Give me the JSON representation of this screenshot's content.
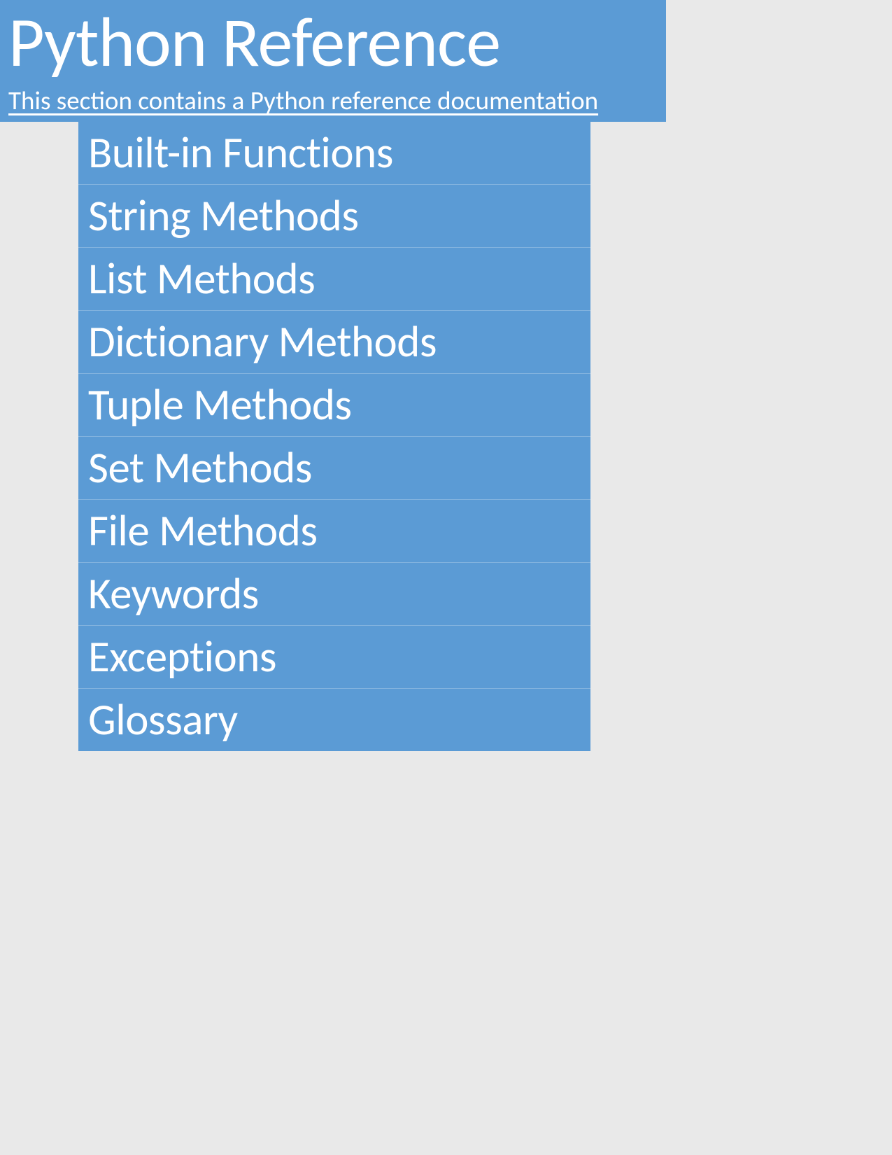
{
  "header": {
    "title": "Python Reference",
    "subtitle": "This section contains a Python reference documentation"
  },
  "menu": {
    "items": [
      {
        "label": "Built-in Functions"
      },
      {
        "label": "String Methods"
      },
      {
        "label": "List Methods"
      },
      {
        "label": "Dictionary Methods"
      },
      {
        "label": "Tuple Methods"
      },
      {
        "label": "Set Methods"
      },
      {
        "label": "File Methods"
      },
      {
        "label": "Keywords"
      },
      {
        "label": "Exceptions"
      },
      {
        "label": "Glossary"
      }
    ]
  }
}
